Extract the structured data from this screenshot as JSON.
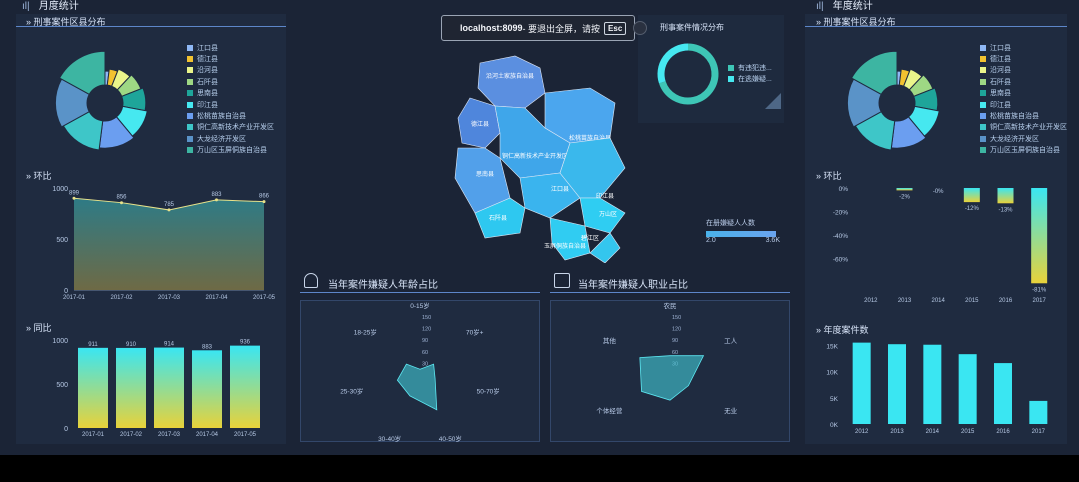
{
  "header": {
    "month_title": "月度统计",
    "year_title": "年度统计"
  },
  "fullscreen_toast": {
    "host": "localhost:8099",
    "message": " - 要退出全屏，请按",
    "key": "Esc"
  },
  "left": {
    "district_title": "刑事案件区县分布",
    "district_legend": [
      {
        "label": "江口县",
        "color": "#8fb8f5"
      },
      {
        "label": "德江县",
        "color": "#f2c230"
      },
      {
        "label": "沿河县",
        "color": "#eaf58a"
      },
      {
        "label": "石阡县",
        "color": "#9ed884"
      },
      {
        "label": "思南县",
        "color": "#1ea59a"
      },
      {
        "label": "印江县",
        "color": "#46e8f0"
      },
      {
        "label": "松桃苗族自治县",
        "color": "#6b9ef0"
      },
      {
        "label": "铜仁高新技术产业开发区",
        "color": "#3ec6c8"
      },
      {
        "label": "大龙经济开发区",
        "color": "#5a93c8"
      },
      {
        "label": "万山区玉屏侗族自治县",
        "color": "#3db5a2"
      }
    ],
    "district_pie": [
      2,
      4,
      6,
      7,
      9,
      11,
      13,
      15,
      16,
      17
    ],
    "huanbi_title": "环比",
    "huanbi_chart": {
      "categories": [
        "2017-01",
        "2017-02",
        "2017-03",
        "2017-04",
        "2017-05"
      ],
      "values": [
        899,
        856,
        785,
        883,
        866
      ],
      "yticks": [
        "1000",
        "500",
        "0"
      ],
      "ylim": [
        0,
        1000
      ]
    },
    "tongbi_title": "同比",
    "tongbi_chart": {
      "categories": [
        "2017-01",
        "2017-02",
        "2017-03",
        "2017-04",
        "2017-05"
      ],
      "values": [
        911,
        910,
        914,
        883,
        936
      ],
      "yticks": [
        "1000",
        "500",
        "0"
      ],
      "ylim": [
        0,
        1000
      ]
    }
  },
  "center": {
    "map_regions": [
      "沿河土家族自治县",
      "德江县",
      "松桃苗族自治县",
      "铜仁高新技术产业开发区",
      "思南县",
      "江口县",
      "印江县",
      "石阡县",
      "万山区",
      "碧江区",
      "玉屏侗族自治县"
    ],
    "visual_map": {
      "title": "在册嫌疑人人数",
      "min": "2.0",
      "max": "3.6K"
    },
    "case_type_title": "刑事案件情况分布",
    "case_type_legend": [
      "有违犯违...",
      "在逃嫌疑..."
    ],
    "case_type_pie": [
      70,
      30
    ],
    "age_title": "当年案件嫌疑人年龄占比",
    "occupation_title": "当年案件嫌疑人职业占比",
    "age_radar": {
      "axes": [
        "0-15岁",
        "70岁+",
        "50-70岁",
        "40-50岁",
        "30-40岁",
        "25-30岁",
        "18-25岁"
      ],
      "values": [
        15,
        45,
        40,
        100,
        60,
        60,
        45
      ],
      "ticks": [
        "150",
        "120",
        "90",
        "60",
        "30"
      ],
      "max": 150
    },
    "occupation_radar": {
      "axes": [
        "农民",
        "工人",
        "无业",
        "学生",
        "个体经营",
        "其他"
      ],
      "values": [
        50,
        100,
        55,
        65,
        85,
        90
      ],
      "ticks": [
        "150",
        "120",
        "90",
        "60",
        "30"
      ],
      "max": 150
    }
  },
  "right": {
    "district_title": "刑事案件区县分布",
    "district_legend": [
      {
        "label": "江口县",
        "color": "#8fb8f5"
      },
      {
        "label": "德江县",
        "color": "#f2c230"
      },
      {
        "label": "沿河县",
        "color": "#eaf58a"
      },
      {
        "label": "石阡县",
        "color": "#9ed884"
      },
      {
        "label": "思南县",
        "color": "#1ea59a"
      },
      {
        "label": "印江县",
        "color": "#46e8f0"
      },
      {
        "label": "松桃苗族自治县",
        "color": "#6b9ef0"
      },
      {
        "label": "铜仁高新技术产业开发区",
        "color": "#3ec6c8"
      },
      {
        "label": "大龙经济开发区",
        "color": "#5a93c8"
      },
      {
        "label": "万山区玉屏侗族自治县",
        "color": "#3db5a2"
      }
    ],
    "district_pie": [
      2,
      4,
      6,
      7,
      9,
      11,
      13,
      15,
      16,
      17
    ],
    "huanbi_title": "环比",
    "huanbi_chart": {
      "categories": [
        "2012",
        "2013",
        "2014",
        "2015",
        "2016",
        "2017"
      ],
      "values": [
        -2,
        null,
        -12,
        -13,
        -81
      ],
      "labels": [
        "-2%",
        "-0%",
        "-12%",
        "-13%",
        "-81%"
      ],
      "yticks": [
        "0%",
        "-20%",
        "-40%",
        "-60%"
      ],
      "ylim": [
        -85,
        0
      ]
    },
    "count_title": "年度案件数",
    "count_chart": {
      "categories": [
        "2012",
        "2013",
        "2014",
        "2015",
        "2016",
        "2017"
      ],
      "values": [
        155000,
        152000,
        151000,
        133000,
        116000,
        44000
      ],
      "yticks": [
        "15K",
        "10K",
        "5K",
        "0K"
      ],
      "ylim": [
        0,
        160000
      ]
    }
  }
}
